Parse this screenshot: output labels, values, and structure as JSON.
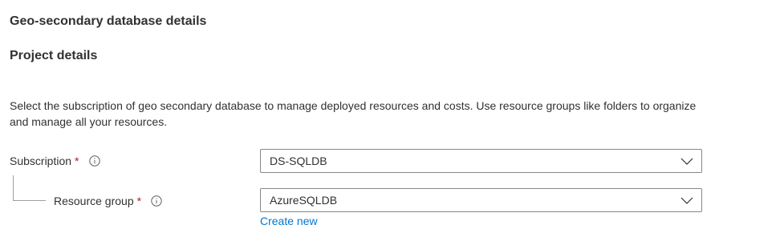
{
  "sections": {
    "geo_secondary_title": "Geo-secondary database details",
    "project_title": "Project details"
  },
  "description": "Select the subscription of geo secondary database to manage deployed resources and costs. Use resource groups like folders to organize and manage all your resources.",
  "fields": {
    "subscription": {
      "label": "Subscription",
      "required_mark": "*",
      "value": "DS-SQLDB"
    },
    "resource_group": {
      "label": "Resource group",
      "required_mark": "*",
      "value": "AzureSQLDB",
      "create_new_label": "Create new"
    }
  },
  "icons": {
    "info": "info-icon",
    "dropdown": "chevron-down-icon"
  },
  "colors": {
    "text": "#323130",
    "required": "#a4262c",
    "link": "#0078d4",
    "border": "#8a8886"
  }
}
